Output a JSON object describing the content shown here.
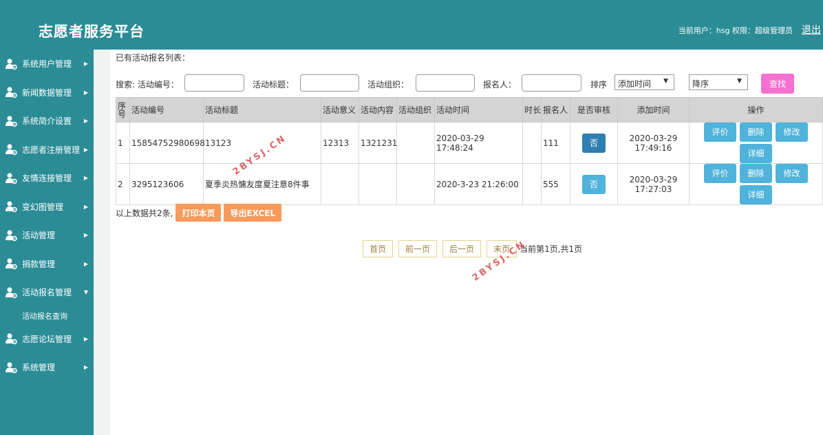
{
  "header": {
    "app_title": "志愿者服务平台",
    "user_info": "当前用户：hsg 权限：超级管理员",
    "logout": "退出"
  },
  "sidebar": {
    "items": [
      {
        "label": "系统用户管理"
      },
      {
        "label": "新闻数据管理"
      },
      {
        "label": "系统简介设置"
      },
      {
        "label": "志愿者注册管理"
      },
      {
        "label": "友情连接管理"
      },
      {
        "label": "变幻图管理"
      },
      {
        "label": "活动管理"
      },
      {
        "label": "捐款管理"
      },
      {
        "label": "活动报名管理"
      },
      {
        "label": "志愿论坛管理"
      },
      {
        "label": "系统管理"
      }
    ],
    "submenu_label": "活动报名查询"
  },
  "main": {
    "section_title": "已有活动报名列表：",
    "search": {
      "prefix": "搜索: 活动编号：",
      "title_label": "活动标题：",
      "org_label": "活动组织：",
      "person_label": "报名人：",
      "sort_label": "排序",
      "sort_field": "添加时间",
      "sort_order": "降序",
      "search_button": "查找"
    },
    "table": {
      "headers": [
        "序号",
        "活动编号",
        "活动标题",
        "活动意义",
        "活动内容",
        "活动组织",
        "活动时间",
        "时长",
        "报名人",
        "是否审核",
        "添加时间",
        "操作"
      ],
      "rows": [
        {
          "index": "1",
          "code": "15854752980698",
          "title": "13123",
          "meaning": "12313",
          "content": "1321231",
          "org": "",
          "time": "2020-03-29 17:48:24",
          "duration": "",
          "person": "111",
          "audit": "否",
          "added_date": "2020-03-29",
          "added_time": "17:49:16"
        },
        {
          "index": "2",
          "code": "3295123606",
          "title": "夏季炎热慵友度夏注意8件事",
          "meaning": "",
          "content": "",
          "org": "",
          "time": "2020-3-23 21:26:00",
          "duration": "",
          "person": "555",
          "audit": "否",
          "added_date": "2020-03-29",
          "added_time": "17:27:03"
        }
      ],
      "op_labels": {
        "review": "评价",
        "delete": "删除",
        "edit": "修改",
        "detail": "详细"
      }
    },
    "footer": {
      "count_text": "以上数据共2条,",
      "print_button": "打印本页",
      "export_button": "导出EXCEL"
    },
    "pager": {
      "first": "首页",
      "prev": "前一页",
      "next": "后一页",
      "last": "末页",
      "status": "当前第1页,共1页"
    },
    "watermarks": [
      "2BYSJ.CN",
      "2BYSJ.CN"
    ]
  },
  "colors": {
    "teal": "#2b8c96",
    "blue_button": "#4fb3db",
    "pink_button": "#f570d0",
    "orange_button": "#f89a5b"
  }
}
